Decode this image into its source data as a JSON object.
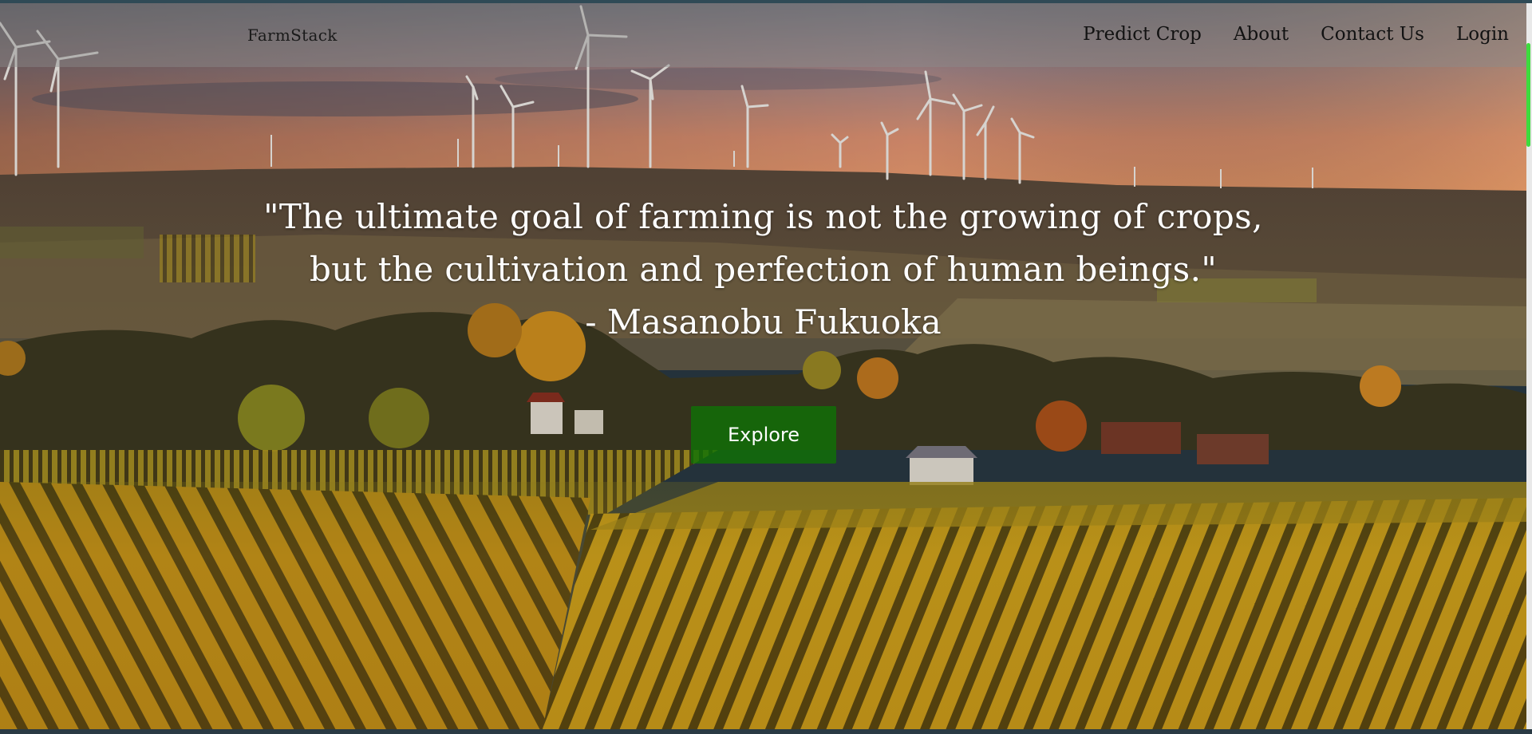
{
  "brand": {
    "name": "FarmStack"
  },
  "nav": {
    "items": [
      {
        "label": "Predict Crop"
      },
      {
        "label": "About"
      },
      {
        "label": "Contact Us"
      },
      {
        "label": "Login"
      }
    ]
  },
  "hero": {
    "quote_line_1": "\"The ultimate goal of farming is not the growing of crops,",
    "quote_line_2": "but the cultivation and perfection of human beings.\"",
    "author": "- Masanobu Fukuoka",
    "button_label": "Explore",
    "background": "vineyard-sunset-wind-turbines-image"
  },
  "colors": {
    "button": "#107006",
    "navbar": "#8c8c8c",
    "scroll_thumb": "#3ddc3d"
  }
}
